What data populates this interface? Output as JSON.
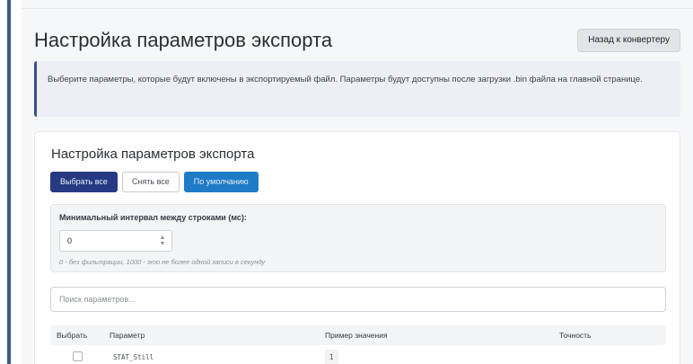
{
  "header": {
    "title": "Настройка параметров экспорта",
    "back_button": "Назад к конвертеру"
  },
  "info": {
    "text": "Выберите параметры, которые будут включены в экспортируемый файл. Параметры будут доступны после загрузки .bin файла на главной странице."
  },
  "card": {
    "title": "Настройка параметров экспорта",
    "buttons": {
      "select_all": "Выбрать все",
      "clear_all": "Снять все",
      "default": "По умолчанию"
    },
    "interval": {
      "label": "Минимальный интервал между строками (мс):",
      "value": "0",
      "hint": "0 - без фильтрации, 1000 - это не более одной записи в секунду"
    },
    "search": {
      "placeholder": "Поиск параметров..."
    },
    "table": {
      "headers": [
        "Выбрать",
        "Параметр",
        "Пример значения",
        "Точность"
      ],
      "rows": [
        {
          "checked": false,
          "param": "STAT_Still",
          "example": "1",
          "precision": ""
        }
      ]
    }
  },
  "colors": {
    "primary_dark": "#263a83",
    "primary_info": "#1f7bc6",
    "accent_bar": "#3e5a8e"
  }
}
